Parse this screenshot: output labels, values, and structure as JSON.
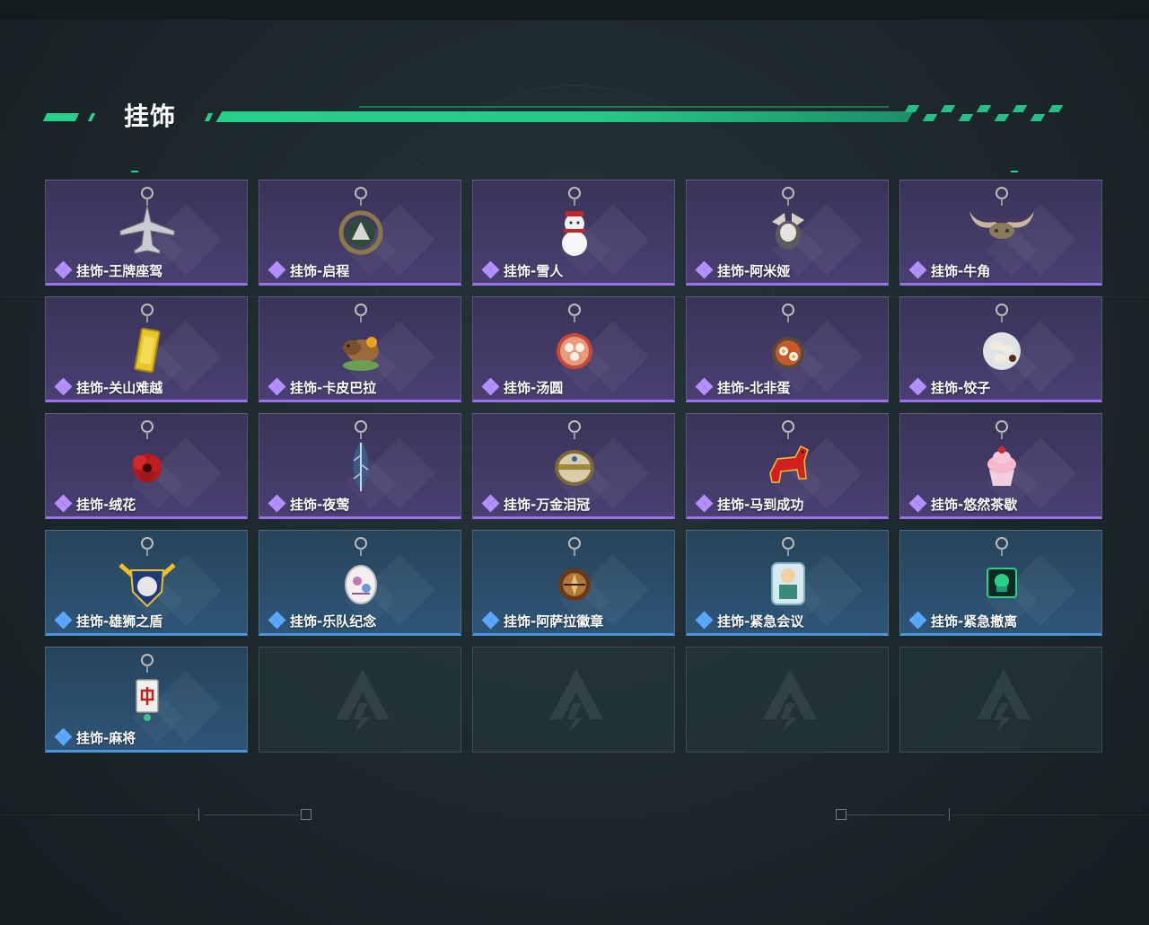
{
  "header": {
    "title": "挂饰"
  },
  "items": [
    {
      "name": "挂饰-王牌座驾",
      "rarity": "purple",
      "icon": "jet-plane-charm-icon"
    },
    {
      "name": "挂饰-启程",
      "rarity": "purple",
      "icon": "ring-medallion-charm-icon"
    },
    {
      "name": "挂饰-雪人",
      "rarity": "purple",
      "icon": "snowman-charm-icon"
    },
    {
      "name": "挂饰-阿米娅",
      "rarity": "purple",
      "icon": "rabbit-charm-icon"
    },
    {
      "name": "挂饰-牛角",
      "rarity": "purple",
      "icon": "bull-horns-charm-icon"
    },
    {
      "name": "挂饰-关山难越",
      "rarity": "purple",
      "icon": "gold-bar-charm-icon"
    },
    {
      "name": "挂饰-卡皮巴拉",
      "rarity": "purple",
      "icon": "capybara-charm-icon"
    },
    {
      "name": "挂饰-汤圆",
      "rarity": "purple",
      "icon": "rice-ball-bowl-charm-icon"
    },
    {
      "name": "挂饰-北非蛋",
      "rarity": "purple",
      "icon": "shakshuka-charm-icon"
    },
    {
      "name": "挂饰-饺子",
      "rarity": "purple",
      "icon": "dumplings-plate-charm-icon"
    },
    {
      "name": "挂饰-绒花",
      "rarity": "purple",
      "icon": "red-flower-charm-icon"
    },
    {
      "name": "挂饰-夜莺",
      "rarity": "purple",
      "icon": "feather-charm-icon"
    },
    {
      "name": "挂饰-万金泪冠",
      "rarity": "purple",
      "icon": "jeweled-crown-charm-icon"
    },
    {
      "name": "挂饰-马到成功",
      "rarity": "purple",
      "icon": "red-horse-charm-icon"
    },
    {
      "name": "挂饰-悠然茶歇",
      "rarity": "purple",
      "icon": "cupcake-charm-icon"
    },
    {
      "name": "挂饰-雄狮之盾",
      "rarity": "blue",
      "icon": "lion-shield-charm-icon"
    },
    {
      "name": "挂饰-乐队纪念",
      "rarity": "blue",
      "icon": "band-badge-charm-icon"
    },
    {
      "name": "挂饰-阿萨拉徽章",
      "rarity": "blue",
      "icon": "emblem-charm-icon"
    },
    {
      "name": "挂饰-紧急会议",
      "rarity": "blue",
      "icon": "acrylic-figure-charm-icon"
    },
    {
      "name": "挂饰-紧急撤离",
      "rarity": "blue",
      "icon": "green-cube-charm-icon"
    },
    {
      "name": "挂饰-麻将",
      "rarity": "blue",
      "icon": "mahjong-tile-charm-icon"
    }
  ],
  "empty_slots": 4,
  "colors": {
    "accent": "#27d18a",
    "purple_rarity": "#9a73e8",
    "blue_rarity": "#4a95dd"
  }
}
